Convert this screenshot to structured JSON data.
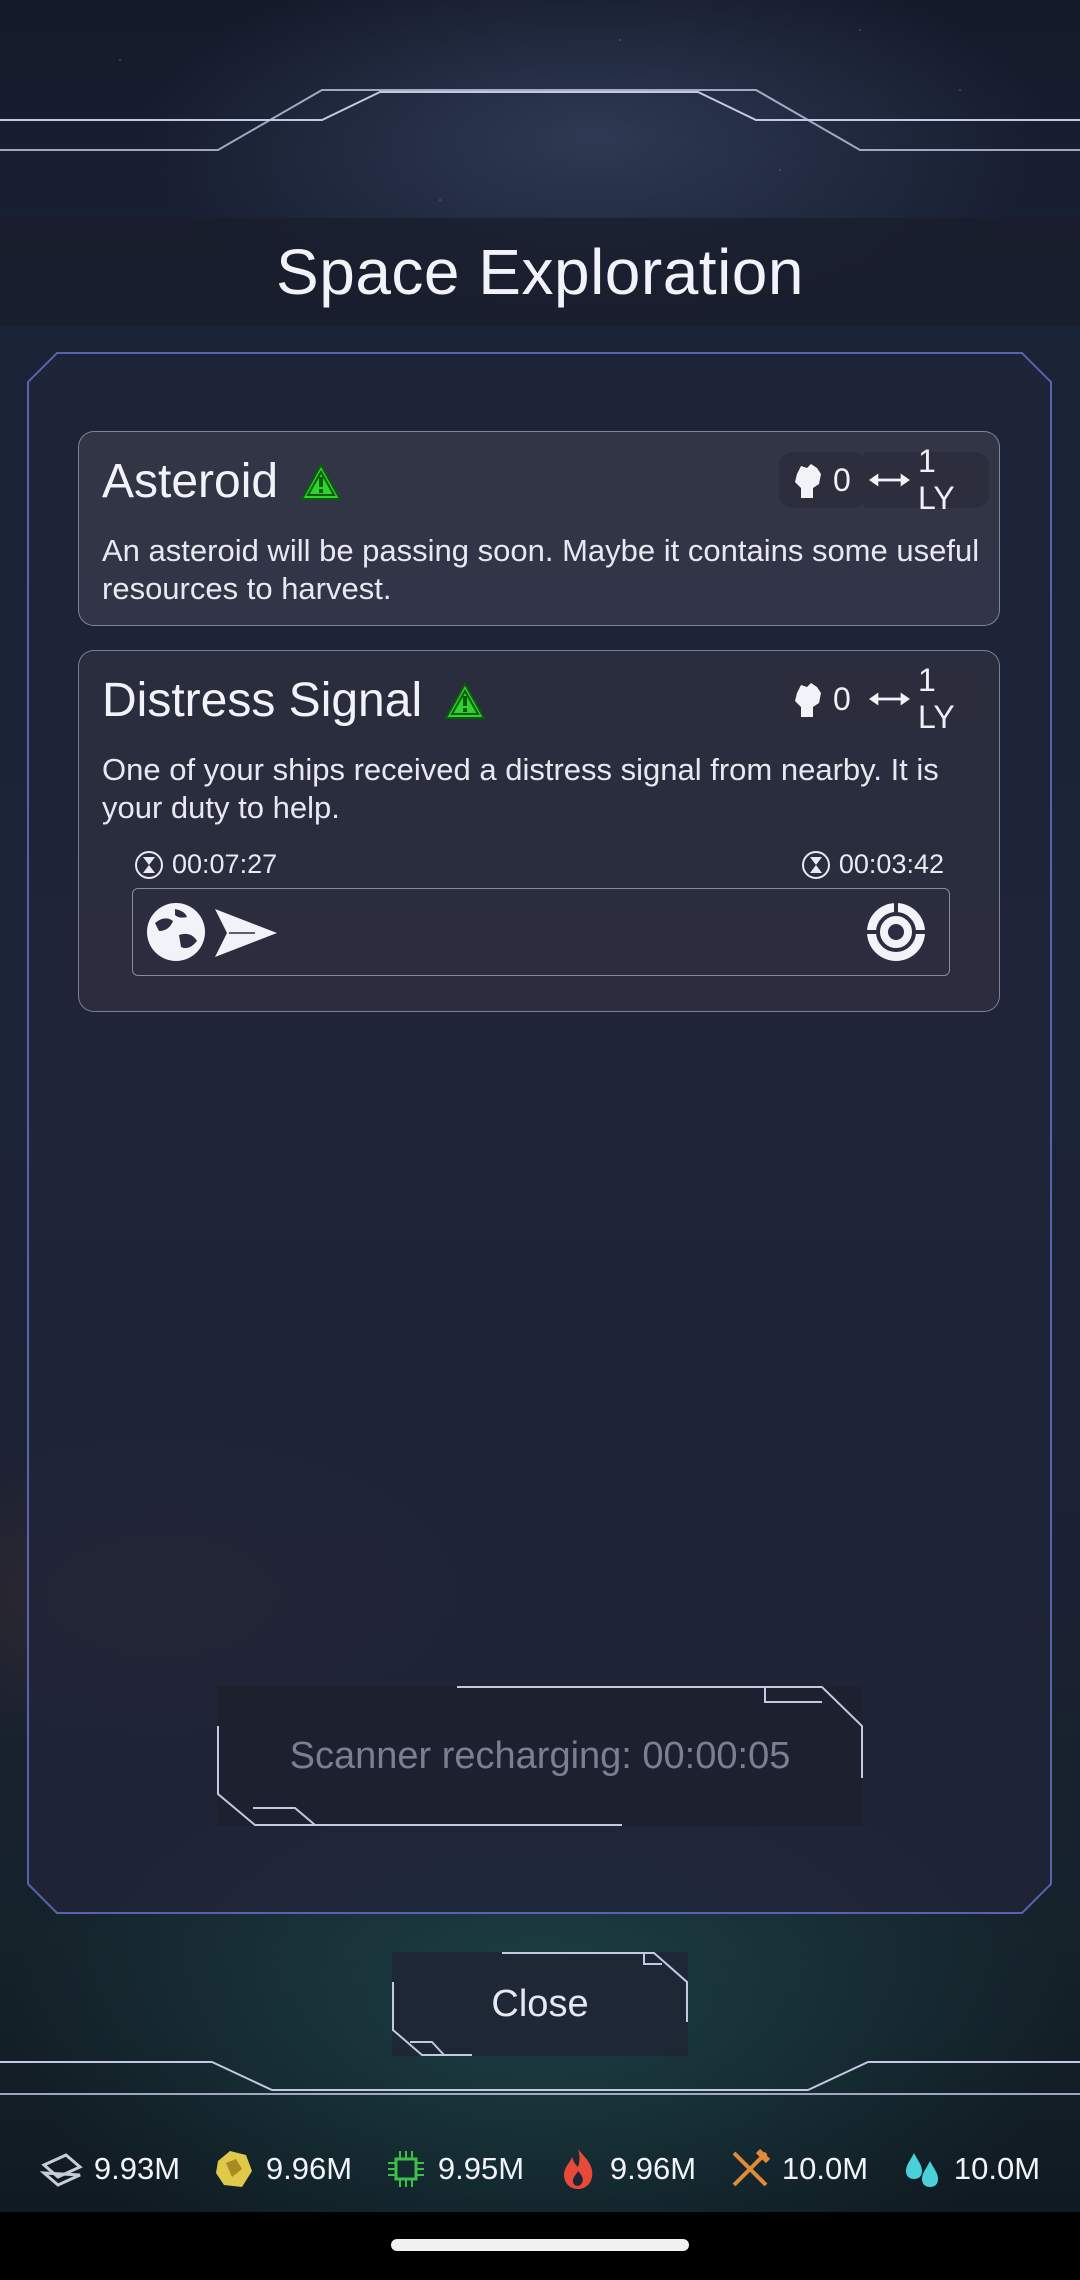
{
  "header": {
    "title": "Space Exploration"
  },
  "events": [
    {
      "title": "Asteroid",
      "power": "0",
      "distance": "1 LY",
      "description": "An asteroid will be passing soon. Maybe it contains some useful resources to harvest."
    },
    {
      "title": "Distress Signal",
      "power": "0",
      "distance": "1 LY",
      "description": "One of your ships received a distress signal from nearby. It is your duty to help.",
      "mission": {
        "elapsed": "00:07:27",
        "remaining": "00:03:42",
        "progress": 0.05
      }
    }
  ],
  "scanner": {
    "label": "Scanner recharging: 00:00:05"
  },
  "footer": {
    "close_label": "Close"
  },
  "resources": [
    {
      "icon": "metal-icon",
      "value": "9.93M",
      "color": "#c8ccd8"
    },
    {
      "icon": "gold-ore-icon",
      "value": "9.96M",
      "color": "#e0c84a"
    },
    {
      "icon": "circuit-icon",
      "value": "9.95M",
      "color": "#3cc048"
    },
    {
      "icon": "fire-icon",
      "value": "9.96M",
      "color": "#e84a3a"
    },
    {
      "icon": "food-icon",
      "value": "10.0M",
      "color": "#e08a3a"
    },
    {
      "icon": "water-icon",
      "value": "10.0M",
      "color": "#4ad0d8"
    }
  ],
  "colors": {
    "warning": "#2ed32e",
    "frame": "#c4c8e2",
    "panel_border": "#6c78d8"
  }
}
